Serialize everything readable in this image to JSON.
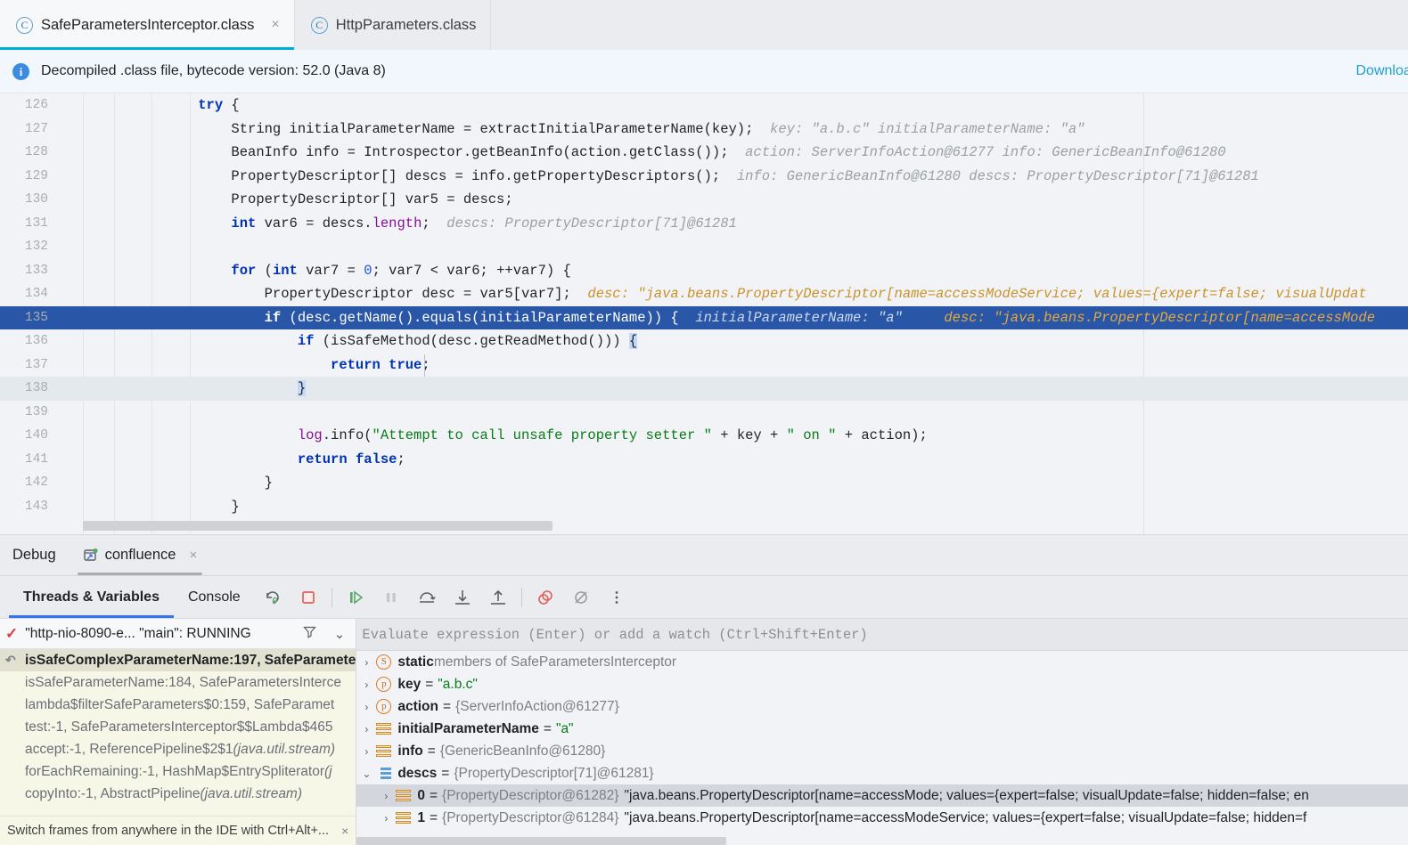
{
  "tabs": [
    {
      "label": "SafeParametersInterceptor.class",
      "icon": "class-icon",
      "active": true,
      "close": "×"
    },
    {
      "label": "HttpParameters.class",
      "icon": "class-icon",
      "active": false
    }
  ],
  "banner": {
    "icon": "info-icon",
    "text": "Decompiled .class file, bytecode version: 52.0 (Java 8)",
    "link": "Download..."
  },
  "editor": {
    "lines": [
      {
        "num": "126",
        "code": "try {"
      },
      {
        "num": "127",
        "code": "String initialParameterName = extractInitialParameterName(key);",
        "hint": "key: \"a.b.c\"     initialParameterName: \"a\""
      },
      {
        "num": "128",
        "code": "BeanInfo info = Introspector.getBeanInfo(action.getClass());",
        "hint": "action: ServerInfoAction@61277     info: GenericBeanInfo@61280"
      },
      {
        "num": "129",
        "code": "PropertyDescriptor[] descs = info.getPropertyDescriptors();",
        "hint": "info: GenericBeanInfo@61280    descs: PropertyDescriptor[71]@61281"
      },
      {
        "num": "130",
        "code": "PropertyDescriptor[] var5 = descs;"
      },
      {
        "num": "131",
        "code": "int var6 = descs.length;",
        "hint": "descs: PropertyDescriptor[71]@61281"
      },
      {
        "num": "132",
        "code": ""
      },
      {
        "num": "133",
        "code": "for (int var7 = 0; var7 < var6; ++var7) {"
      },
      {
        "num": "134",
        "code": "PropertyDescriptor desc = var5[var7];",
        "hint": "desc: \"java.beans.PropertyDescriptor[name=accessModeService; values={expert=false; visualUpdat"
      },
      {
        "num": "135",
        "code": "if (desc.getName().equals(initialParameterName)) {",
        "hint": "initialParameterName: \"a\"     desc: \"java.beans.PropertyDescriptor[name=accessMode",
        "highlighted": true
      },
      {
        "num": "136",
        "code": "if (isSafeMethod(desc.getReadMethod())) {"
      },
      {
        "num": "137",
        "code": "return true;"
      },
      {
        "num": "138",
        "code": "}",
        "bulb": true
      },
      {
        "num": "139",
        "code": ""
      },
      {
        "num": "140",
        "code": "log.info(\"Attempt to call unsafe property setter \" + key + \" on \" + action);"
      },
      {
        "num": "141",
        "code": "return false;"
      },
      {
        "num": "142",
        "code": "}"
      },
      {
        "num": "143",
        "code": "}"
      }
    ]
  },
  "debug": {
    "title": "Debug",
    "run_config": "confluence",
    "run_config_close": "×",
    "tabs": [
      {
        "label": "Threads & Variables",
        "selected": true
      },
      {
        "label": "Console",
        "selected": false
      }
    ],
    "toolbar_icons": [
      "rerun-icon",
      "stop-icon",
      "resume-icon",
      "pause-icon",
      "step-over-icon",
      "step-into-icon",
      "step-out-icon",
      "mute-breakpoints-icon",
      "view-breakpoints-icon",
      "more-options-icon"
    ],
    "thread": {
      "status_icon": "running-check-icon",
      "name": "\"http-nio-8090-e... \"main\": RUNNING",
      "filter_icon": "filter-icon",
      "chevron_icon": "chevron-down-icon"
    },
    "frames": [
      {
        "text": "isSafeComplexParameterName:197, SafeParamete",
        "selected": true,
        "icon": "frame-return-icon"
      },
      {
        "text": "isSafeParameterName:184, SafeParametersInterce",
        "selected": false
      },
      {
        "text": "lambda$filterSafeParameters$0:159, SafeParamet",
        "selected": false
      },
      {
        "text": "test:-1, SafeParametersInterceptor$$Lambda$465",
        "selected": false
      },
      {
        "text": "accept:-1, ReferencePipeline$2$1 ",
        "italic": "(java.util.stream)",
        "selected": false
      },
      {
        "text": "forEachRemaining:-1, HashMap$EntrySpliterator ",
        "italic": "(j",
        "selected": false
      },
      {
        "text": "copyInto:-1, AbstractPipeline ",
        "italic": "(java.util.stream)",
        "selected": false
      }
    ],
    "frames_hint": "Switch frames from anywhere in the IDE with Ctrl+Alt+...",
    "frames_hint_close": "×",
    "evaluate_placeholder": "Evaluate expression (Enter) or add a watch (Ctrl+Shift+Enter)",
    "variables": [
      {
        "arrow": "›",
        "icon": "static-icon",
        "icon_letter": "S",
        "name": "static",
        "suffix": " members of SafeParametersInterceptor",
        "indent": 0,
        "selected": false
      },
      {
        "arrow": "›",
        "icon": "parameter-icon",
        "icon_letter": "p",
        "name": "key",
        "eq": "=",
        "value": "\"a.b.c\"",
        "value_type": "string",
        "indent": 0,
        "selected": false
      },
      {
        "arrow": "›",
        "icon": "parameter-icon",
        "icon_letter": "p",
        "name": "action",
        "eq": "=",
        "value": "{ServerInfoAction@61277}",
        "value_type": "ref",
        "indent": 0,
        "selected": false
      },
      {
        "arrow": "›",
        "icon": "local-var-icon",
        "name": "initialParameterName",
        "eq": "=",
        "value": "\"a\"",
        "value_type": "string",
        "indent": 0,
        "selected": false
      },
      {
        "arrow": "›",
        "icon": "local-var-icon",
        "name": "info",
        "eq": "=",
        "value": "{GenericBeanInfo@61280}",
        "value_type": "ref",
        "indent": 0,
        "selected": false
      },
      {
        "arrow": "⌄",
        "icon": "array-icon",
        "name": "descs",
        "eq": "=",
        "value": "{PropertyDescriptor[71]@61281}",
        "value_type": "ref",
        "indent": 0,
        "selected": false,
        "expanded": true
      },
      {
        "arrow": "›",
        "icon": "local-var-icon",
        "name": "0",
        "eq": "=",
        "value": "{PropertyDescriptor@61282}",
        "value_type": "ref",
        "desc": "\"java.beans.PropertyDescriptor[name=accessMode; values={expert=false; visualUpdate=false; hidden=false; en",
        "indent": 1,
        "selected": true
      },
      {
        "arrow": "›",
        "icon": "local-var-icon",
        "name": "1",
        "eq": "=",
        "value": "{PropertyDescriptor@61284}",
        "value_type": "ref",
        "desc": "\"java.beans.PropertyDescriptor[name=accessModeService; values={expert=false; visualUpdate=false; hidden=f",
        "indent": 1,
        "selected": false
      }
    ]
  },
  "colors": {
    "accent": "#3574f0",
    "tab_underline": "#00aedd",
    "highlight_line": "#2a56a8",
    "keyword": "#0033b3",
    "string": "#067d17",
    "field": "#871094",
    "hint": "#9aa0a6",
    "hint_string": "#c9922b",
    "frames_bg": "#f7f7e8"
  }
}
